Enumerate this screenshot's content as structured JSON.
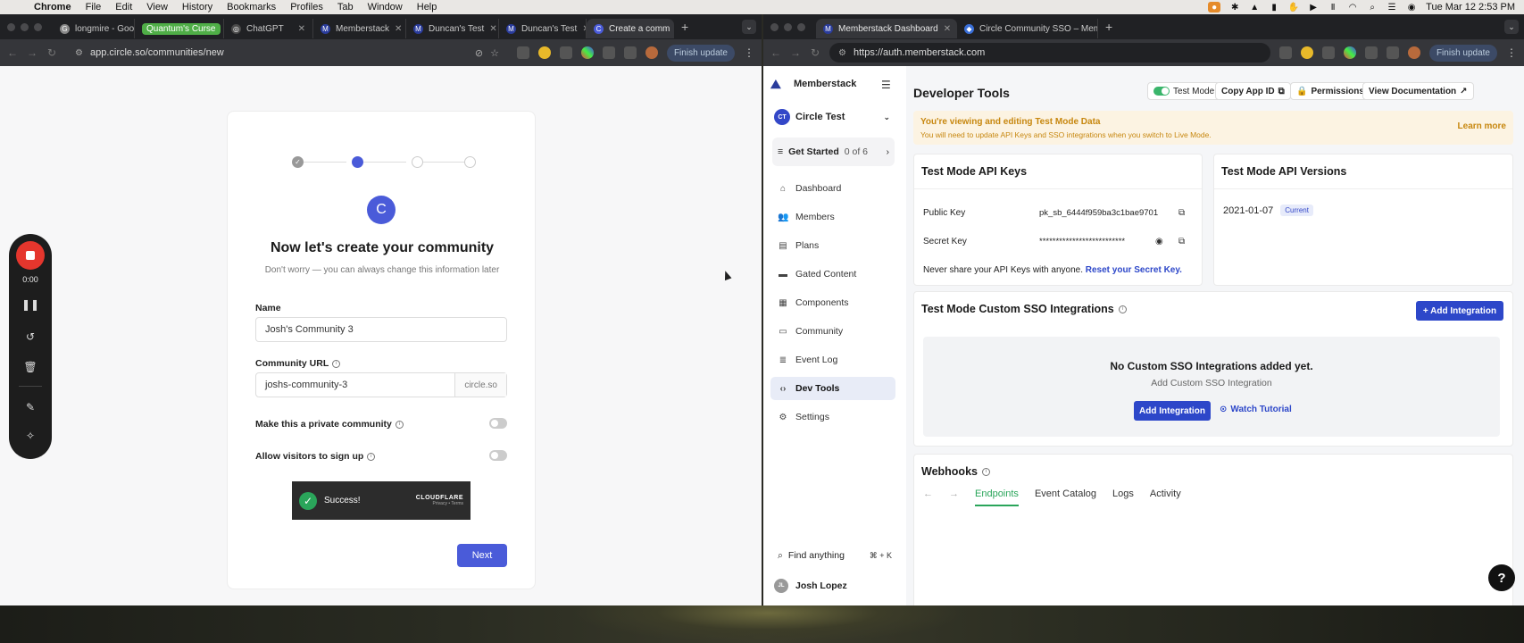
{
  "menubar": {
    "app": "Chrome",
    "menus": [
      "File",
      "Edit",
      "View",
      "History",
      "Bookmarks",
      "Profiles",
      "Tab",
      "Window",
      "Help"
    ],
    "datetime": "Tue Mar 12  2:53 PM"
  },
  "left_browser": {
    "tabs": [
      {
        "label": "longmire - Goo"
      },
      {
        "label": "Quantum's Curse",
        "group": true
      },
      {
        "label": "ChatGPT"
      },
      {
        "label": "Memberstack"
      },
      {
        "label": "Duncan's Test"
      },
      {
        "label": "Duncan's Test"
      },
      {
        "label": "Create a comm",
        "active": true
      }
    ],
    "url": "app.circle.so/communities/new",
    "finish_update": "Finish update"
  },
  "circle": {
    "avatar_letter": "C",
    "title": "Now let's create your community",
    "subtitle": "Don't worry — you can always change this information later",
    "name_label": "Name",
    "name_value": "Josh's Community 3",
    "url_label": "Community URL",
    "url_value": "joshs-community-3",
    "url_suffix": "circle.so",
    "private_label": "Make this a private community",
    "signup_label": "Allow visitors to sign up",
    "captcha_text": "Success!",
    "captcha_brand": "CLOUDFLARE",
    "captcha_links": "Privacy  •  Terms",
    "next": "Next"
  },
  "recorder": {
    "time": "0:00"
  },
  "right_browser": {
    "tabs": [
      {
        "label": "Memberstack Dashboard",
        "active": true
      },
      {
        "label": "Circle Community SSO – Mem"
      }
    ],
    "url": "https://auth.memberstack.com",
    "finish_update": "Finish update"
  },
  "memberstack": {
    "brand": "Memberstack",
    "workspace": {
      "initials": "CT",
      "name": "Circle Test"
    },
    "get_started": {
      "label": "Get Started",
      "count": "0 of 6"
    },
    "nav": [
      {
        "label": "Dashboard",
        "icon": "home-icon"
      },
      {
        "label": "Members",
        "icon": "members-icon"
      },
      {
        "label": "Plans",
        "icon": "plans-icon"
      },
      {
        "label": "Gated Content",
        "icon": "folder-icon"
      },
      {
        "label": "Components",
        "icon": "grid-icon"
      },
      {
        "label": "Community",
        "icon": "chat-icon"
      },
      {
        "label": "Event Log",
        "icon": "list-icon"
      },
      {
        "label": "Dev Tools",
        "icon": "code-icon",
        "active": true
      },
      {
        "label": "Settings",
        "icon": "gear-icon"
      }
    ],
    "find": {
      "label": "Find anything",
      "shortcut": "⌘ + K"
    },
    "user": {
      "initials": "JL",
      "name": "Josh Lopez"
    },
    "page_title": "Developer Tools",
    "top_buttons": {
      "test_mode": "Test Mode",
      "copy_app_id": "Copy App ID",
      "permissions": "Permissions",
      "view_docs": "View Documentation"
    },
    "banner": {
      "title": "You're viewing and editing Test Mode Data",
      "text": "You will need to update API Keys and SSO integrations when you switch to Live Mode.",
      "link": "Learn more"
    },
    "api_keys": {
      "title": "Test Mode API Keys",
      "public_label": "Public Key",
      "public_value": "pk_sb_6444f959ba3c1bae9701",
      "secret_label": "Secret Key",
      "secret_value": "**************************",
      "note": "Never share your API Keys with anyone.",
      "reset": "Reset your Secret Key."
    },
    "api_versions": {
      "title": "Test Mode API Versions",
      "version": "2021-01-07",
      "tag": "Current"
    },
    "sso": {
      "title": "Test Mode Custom SSO Integrations",
      "add_button": "+ Add Integration",
      "empty_title": "No Custom SSO Integrations added yet.",
      "empty_sub": "Add Custom SSO Integration",
      "add_integration": "Add Integration",
      "watch_tutorial": "Watch Tutorial"
    },
    "webhooks": {
      "title": "Webhooks",
      "tabs": [
        "Endpoints",
        "Event Catalog",
        "Logs",
        "Activity"
      ]
    }
  }
}
